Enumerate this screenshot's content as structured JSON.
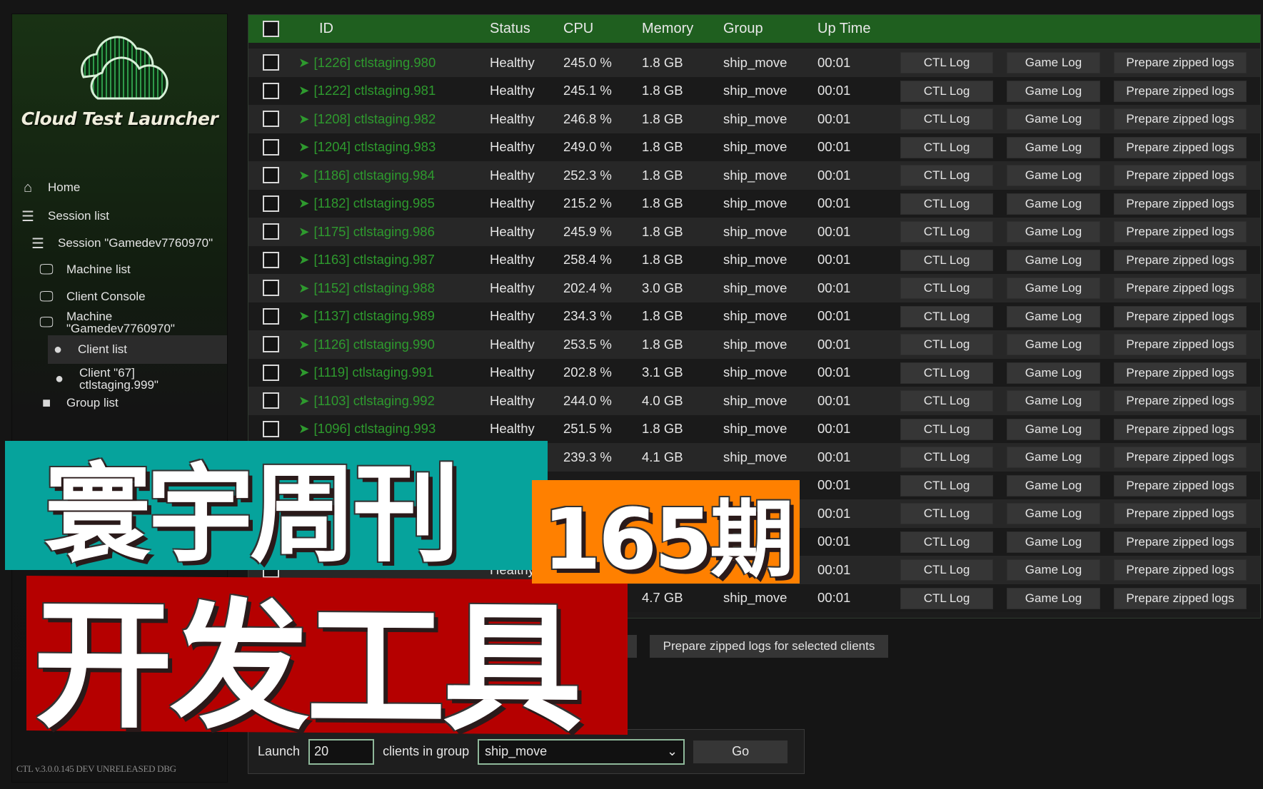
{
  "sidebar": {
    "app_title": "Cloud Test Launcher",
    "version": "CTL v.3.0.0.145 DEV UNRELEASED DBG",
    "items": [
      {
        "label": "Home",
        "icon": "home-icon"
      },
      {
        "label": "Session list",
        "icon": "list-icon"
      },
      {
        "label": "Session \"Gamedev7760970\"",
        "icon": "list-icon"
      },
      {
        "label": "Machine list",
        "icon": "monitor-icon"
      },
      {
        "label": "Client Console",
        "icon": "monitor-icon"
      },
      {
        "label": "Machine \"Gamedev7760970\"",
        "line1": "Machine",
        "line2": "\"Gamedev7760970\"",
        "icon": "monitor-icon"
      },
      {
        "label": "Client list",
        "icon": "user-icon",
        "active": true
      },
      {
        "label": "Client \"67] ctlstaging.999\"",
        "line1": "Client \"67]",
        "line2": "ctlstaging.999\"",
        "icon": "user-icon"
      },
      {
        "label": "Group list",
        "icon": "folder-icon"
      }
    ]
  },
  "table": {
    "headers": {
      "id": "ID",
      "status": "Status",
      "cpu": "CPU",
      "memory": "Memory",
      "group": "Group",
      "uptime": "Up Time"
    },
    "button_labels": {
      "ctl": "CTL Log",
      "game": "Game Log",
      "zip": "Prepare zipped logs"
    },
    "rows": [
      {
        "id": "[1226] ctlstaging.980",
        "status": "Healthy",
        "cpu": "245.0 %",
        "memory": "1.8 GB",
        "group": "ship_move",
        "uptime": "00:01"
      },
      {
        "id": "[1222] ctlstaging.981",
        "status": "Healthy",
        "cpu": "245.1 %",
        "memory": "1.8 GB",
        "group": "ship_move",
        "uptime": "00:01"
      },
      {
        "id": "[1208] ctlstaging.982",
        "status": "Healthy",
        "cpu": "246.8 %",
        "memory": "1.8 GB",
        "group": "ship_move",
        "uptime": "00:01"
      },
      {
        "id": "[1204] ctlstaging.983",
        "status": "Healthy",
        "cpu": "249.0 %",
        "memory": "1.8 GB",
        "group": "ship_move",
        "uptime": "00:01"
      },
      {
        "id": "[1186] ctlstaging.984",
        "status": "Healthy",
        "cpu": "252.3 %",
        "memory": "1.8 GB",
        "group": "ship_move",
        "uptime": "00:01"
      },
      {
        "id": "[1182] ctlstaging.985",
        "status": "Healthy",
        "cpu": "215.2 %",
        "memory": "1.8 GB",
        "group": "ship_move",
        "uptime": "00:01"
      },
      {
        "id": "[1175] ctlstaging.986",
        "status": "Healthy",
        "cpu": "245.9 %",
        "memory": "1.8 GB",
        "group": "ship_move",
        "uptime": "00:01"
      },
      {
        "id": "[1163] ctlstaging.987",
        "status": "Healthy",
        "cpu": "258.4 %",
        "memory": "1.8 GB",
        "group": "ship_move",
        "uptime": "00:01"
      },
      {
        "id": "[1152] ctlstaging.988",
        "status": "Healthy",
        "cpu": "202.4 %",
        "memory": "3.0 GB",
        "group": "ship_move",
        "uptime": "00:01"
      },
      {
        "id": "[1137] ctlstaging.989",
        "status": "Healthy",
        "cpu": "234.3 %",
        "memory": "1.8 GB",
        "group": "ship_move",
        "uptime": "00:01"
      },
      {
        "id": "[1126] ctlstaging.990",
        "status": "Healthy",
        "cpu": "253.5 %",
        "memory": "1.8 GB",
        "group": "ship_move",
        "uptime": "00:01"
      },
      {
        "id": "[1119] ctlstaging.991",
        "status": "Healthy",
        "cpu": "202.8 %",
        "memory": "3.1 GB",
        "group": "ship_move",
        "uptime": "00:01"
      },
      {
        "id": "[1103] ctlstaging.992",
        "status": "Healthy",
        "cpu": "244.0 %",
        "memory": "4.0 GB",
        "group": "ship_move",
        "uptime": "00:01"
      },
      {
        "id": "[1096] ctlstaging.993",
        "status": "Healthy",
        "cpu": "251.5 %",
        "memory": "1.8 GB",
        "group": "ship_move",
        "uptime": "00:01"
      },
      {
        "id": "",
        "status": "",
        "cpu": "239.3 %",
        "memory": "4.1 GB",
        "group": "ship_move",
        "uptime": "00:01"
      },
      {
        "id": "",
        "status": "",
        "cpu": "",
        "memory": "",
        "group": "",
        "uptime": "00:01"
      },
      {
        "id": "",
        "status": "",
        "cpu": "",
        "memory": "",
        "group": "",
        "uptime": "00:01"
      },
      {
        "id": "",
        "status": "",
        "cpu": "",
        "memory": "",
        "group": "",
        "uptime": "00:01"
      },
      {
        "id": "",
        "status": "Healthy",
        "cpu": "",
        "memory": "",
        "group": "",
        "uptime": "00:01"
      },
      {
        "id": "",
        "status": "",
        "cpu": "",
        "memory": "4.7 GB",
        "group": "ship_move",
        "uptime": "00:01"
      }
    ]
  },
  "actions": {
    "prepare_selected": "Prepare zipped logs for selected clients"
  },
  "launch": {
    "label": "Launch",
    "count": "20",
    "middle_label": "clients in group",
    "group": "ship_move",
    "go": "Go"
  },
  "overlay": {
    "title": "寰宇周刊",
    "issue": "165期",
    "topic": "开发工具"
  },
  "colors": {
    "header_green": "#1f5f1f",
    "id_green": "#2e9a2e",
    "teal": "#06a39c",
    "orange": "#ff8000",
    "red": "#b50000"
  }
}
